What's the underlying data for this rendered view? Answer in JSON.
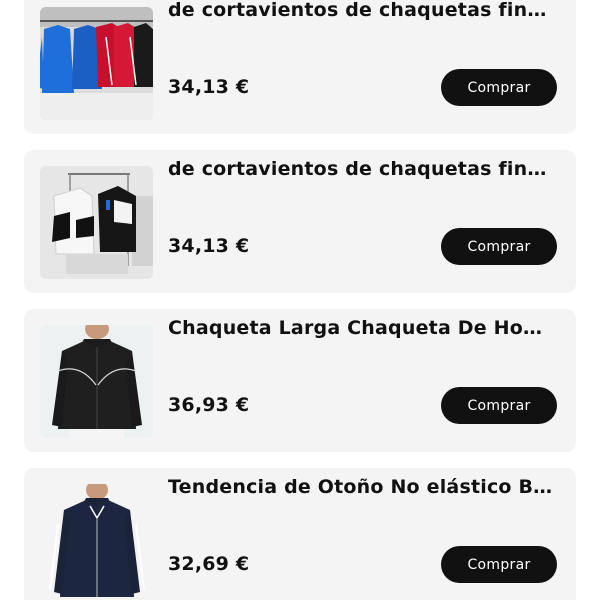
{
  "products": [
    {
      "title": "de cortavientos de chaquetas finas...",
      "price": "34,13 €",
      "button_label": "Comprar",
      "image": "jacket-rack-colorful"
    },
    {
      "title": "de cortavientos de chaquetas finas...",
      "price": "34,13 €",
      "button_label": "Comprar",
      "image": "jackets-black-white-rack"
    },
    {
      "title": "Chaqueta Larga Chaqueta De Homb...",
      "price": "36,93 €",
      "button_label": "Comprar",
      "image": "black-track-jacket-model"
    },
    {
      "title": "Tendencia de Otoño No elástico Bor...",
      "price": "32,69 €",
      "button_label": "Comprar",
      "image": "navy-track-jacket-model"
    }
  ]
}
